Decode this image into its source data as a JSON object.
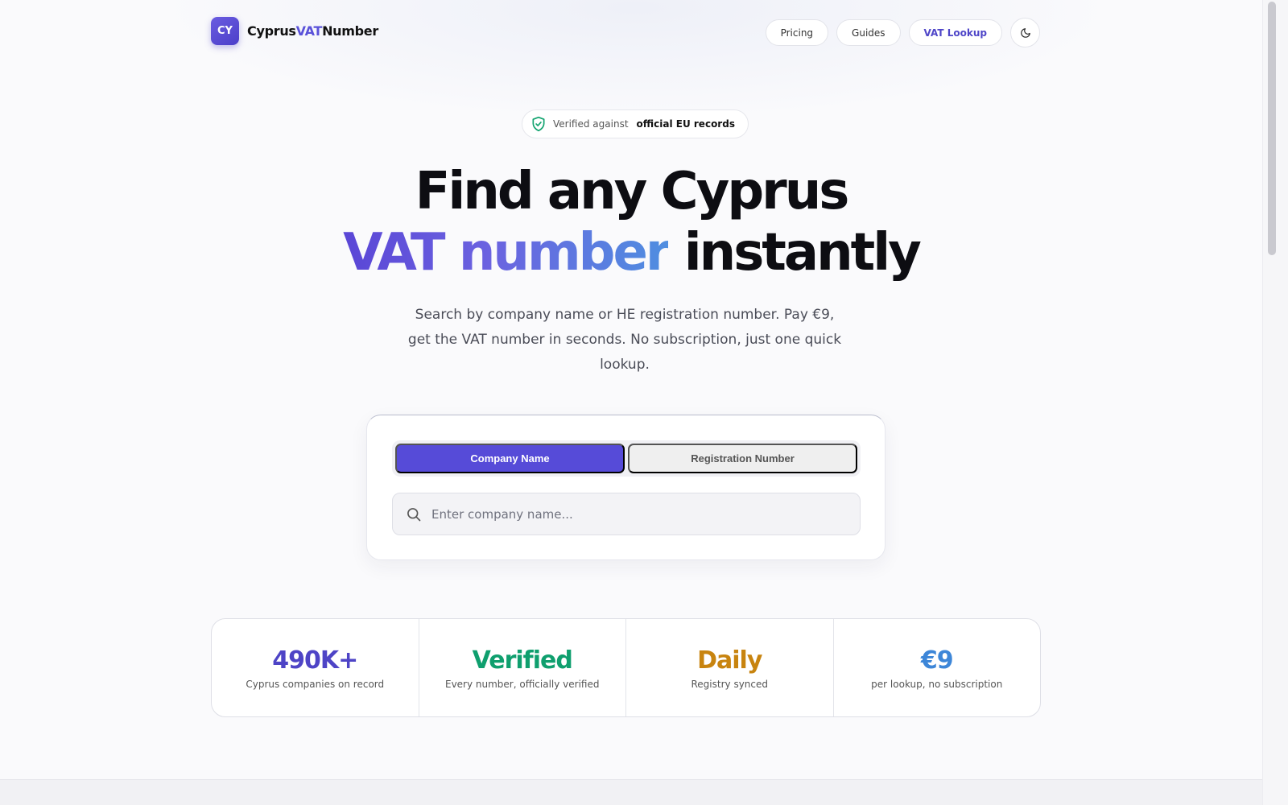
{
  "brand": {
    "logo_text": "CY",
    "name_part1": "Cyprus",
    "name_part2": "VAT",
    "name_part3": "Number",
    "accent_color": "#5a52d9"
  },
  "nav": {
    "items": [
      {
        "label": "Pricing",
        "active": false
      },
      {
        "label": "Guides",
        "active": false
      },
      {
        "label": "VAT Lookup",
        "active": true
      }
    ],
    "theme_toggle_icon": "moon-icon"
  },
  "badge": {
    "icon": "shield-check-icon",
    "text": "Verified against",
    "strong_text": "official EU records"
  },
  "hero": {
    "line1": "Find any Cyprus",
    "line2_highlight": "VAT number",
    "line2_rest": "instantly",
    "subtitle": "Search by company name or HE registration number. Pay €9, get the VAT number in seconds. No subscription, just one quick lookup."
  },
  "search": {
    "tabs": [
      {
        "label": "Company Name",
        "active": true
      },
      {
        "label": "Registration Number",
        "active": false
      }
    ],
    "input_value": "",
    "placeholder": "Enter company name...",
    "icon": "search-icon",
    "active_tab_color": "#564bd8"
  },
  "stats": [
    {
      "value": "490K+",
      "label": "Cyprus companies on record",
      "color": "#4e44c6"
    },
    {
      "value": "Verified",
      "label": "Every number, officially verified",
      "color": "#0f9f6e"
    },
    {
      "value": "Daily",
      "label": "Registry synced",
      "color": "#c8840f"
    },
    {
      "value": "€9",
      "label": "per lookup, no subscription",
      "color": "#3d86d8"
    }
  ]
}
